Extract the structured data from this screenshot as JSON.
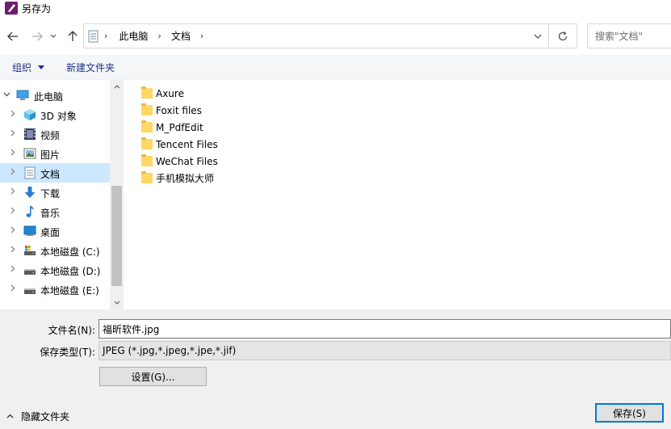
{
  "window": {
    "title": "另存为"
  },
  "address": {
    "breadcrumbs": [
      "此电脑",
      "文档"
    ],
    "search_placeholder": "搜索\"文档\""
  },
  "toolbar": {
    "organize": "组织",
    "new_folder": "新建文件夹"
  },
  "tree": [
    {
      "label": "此电脑",
      "icon": "computer-icon",
      "expanded": true,
      "selected": false
    },
    {
      "label": "3D 对象",
      "icon": "3d-objects-icon",
      "selected": false
    },
    {
      "label": "视频",
      "icon": "video-icon",
      "selected": false
    },
    {
      "label": "图片",
      "icon": "pictures-icon",
      "selected": false
    },
    {
      "label": "文档",
      "icon": "documents-icon",
      "selected": true
    },
    {
      "label": "下载",
      "icon": "download-icon",
      "selected": false
    },
    {
      "label": "音乐",
      "icon": "music-icon",
      "selected": false
    },
    {
      "label": "桌面",
      "icon": "desktop-icon",
      "selected": false
    },
    {
      "label": "本地磁盘 (C:)",
      "icon": "drive-c-icon",
      "selected": false
    },
    {
      "label": "本地磁盘 (D:)",
      "icon": "drive-icon",
      "selected": false
    },
    {
      "label": "本地磁盘 (E:)",
      "icon": "drive-icon",
      "selected": false
    }
  ],
  "files": [
    "Axure",
    "Foxit files",
    "M_PdfEdit",
    "Tencent Files",
    "WeChat Files",
    "手机模拟大师"
  ],
  "form": {
    "filename_label": "文件名(N):",
    "filename_value": "福昕软件.jpg",
    "filetype_label": "保存类型(T):",
    "filetype_value": "JPEG (*.jpg,*.jpeg,*.jpe,*.jif)",
    "settings_button": "设置(G)...",
    "hide_folders": "隐藏文件夹",
    "save_button": "保存(S)"
  },
  "colors": {
    "selection": "#cce8ff",
    "folder": "#ffd764",
    "link": "#1e3287",
    "accent": "#0078d7"
  }
}
